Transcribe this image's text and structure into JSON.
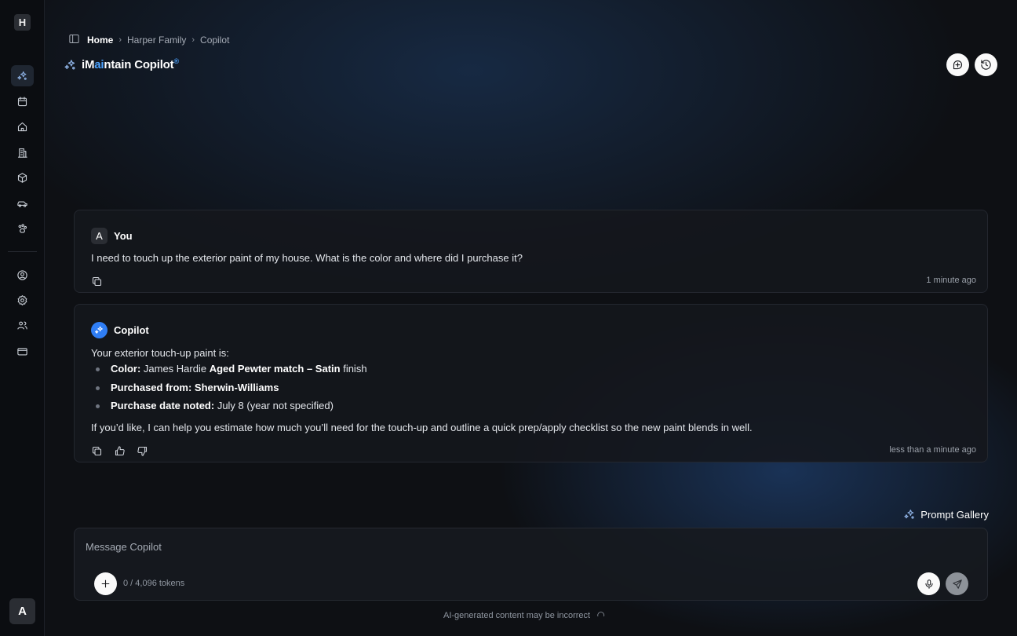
{
  "app": {
    "logo_letter": "H",
    "user_initial": "A"
  },
  "sidebar": {
    "items": [
      {
        "icon": "copilot-sparkle-icon",
        "active": true
      },
      {
        "icon": "calendar-icon"
      },
      {
        "icon": "home-icon"
      },
      {
        "icon": "building-icon"
      },
      {
        "icon": "package-icon"
      },
      {
        "icon": "car-icon"
      },
      {
        "icon": "pets-icon"
      },
      {
        "icon": "user-circle-icon"
      },
      {
        "icon": "settings-gear-icon"
      },
      {
        "icon": "users-icon"
      },
      {
        "icon": "credit-card-icon"
      }
    ]
  },
  "breadcrumb": {
    "home": "Home",
    "family": "Harper Family",
    "current": "Copilot"
  },
  "header": {
    "title_pre": "iM",
    "title_accent": "ai",
    "title_post": "ntain Copilot",
    "title_mark": "®"
  },
  "messages": {
    "user": {
      "initial": "A",
      "name": "You",
      "text": "I need to touch up the exterior paint of my house. What is the color and where did I purchase it?",
      "timestamp": "1 minute ago"
    },
    "bot": {
      "name": "Copilot",
      "intro": "Your exterior touch-up paint is:",
      "bullets": {
        "color_label": "Color:",
        "color_pre": " James Hardie ",
        "color_bold": "Aged Pewter match – Satin",
        "color_post": " finish",
        "purchased_label": "Purchased from: Sherwin-Williams",
        "date_label": "Purchase date noted:",
        "date_value": " July 8 (year not specified)"
      },
      "outro": "If you’d like, I can help you estimate how much you’ll need for the touch-up and outline a quick prep/apply checklist so the new paint blends in well.",
      "timestamp": "less than a minute ago"
    }
  },
  "prompt_gallery": {
    "label": "Prompt Gallery"
  },
  "composer": {
    "placeholder": "Message Copilot",
    "tokens": "0 / 4,096 tokens"
  },
  "disclaimer": "AI-generated content may be incorrect",
  "colors": {
    "accent": "#4da3ff",
    "bot_avatar": "#2f7ef5",
    "background": "#0e1014"
  }
}
